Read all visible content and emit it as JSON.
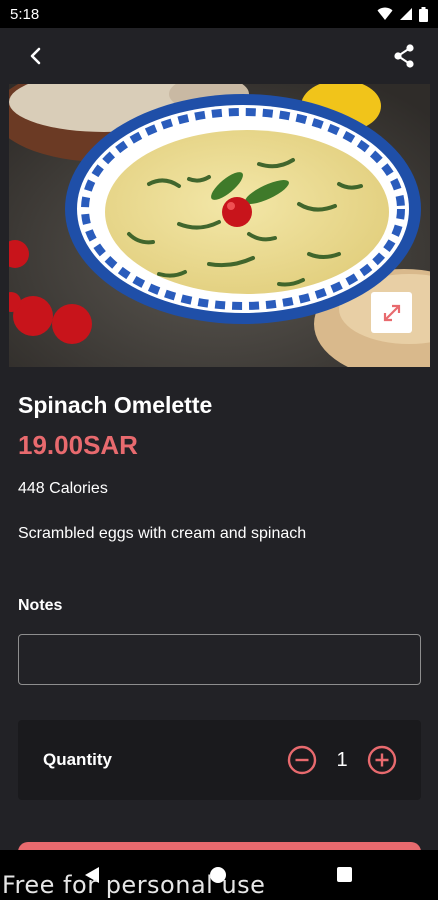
{
  "status": {
    "time": "5:18"
  },
  "product": {
    "title": "Spinach Omelette",
    "price": "19.00SAR",
    "calories": "448 Calories",
    "description": "Scrambled eggs with cream and spinach"
  },
  "notes": {
    "label": "Notes",
    "value": "",
    "placeholder": ""
  },
  "quantity": {
    "label": "Quantity",
    "value": "1"
  },
  "watermark": "Free for personal use",
  "colors": {
    "accent": "#e86a6e",
    "background": "#222226",
    "card": "#1a1a1d"
  },
  "icons": [
    "back-arrow-icon",
    "share-icon",
    "expand-icon",
    "minus-icon",
    "plus-icon",
    "wifi-icon",
    "signal-icon",
    "battery-icon"
  ]
}
